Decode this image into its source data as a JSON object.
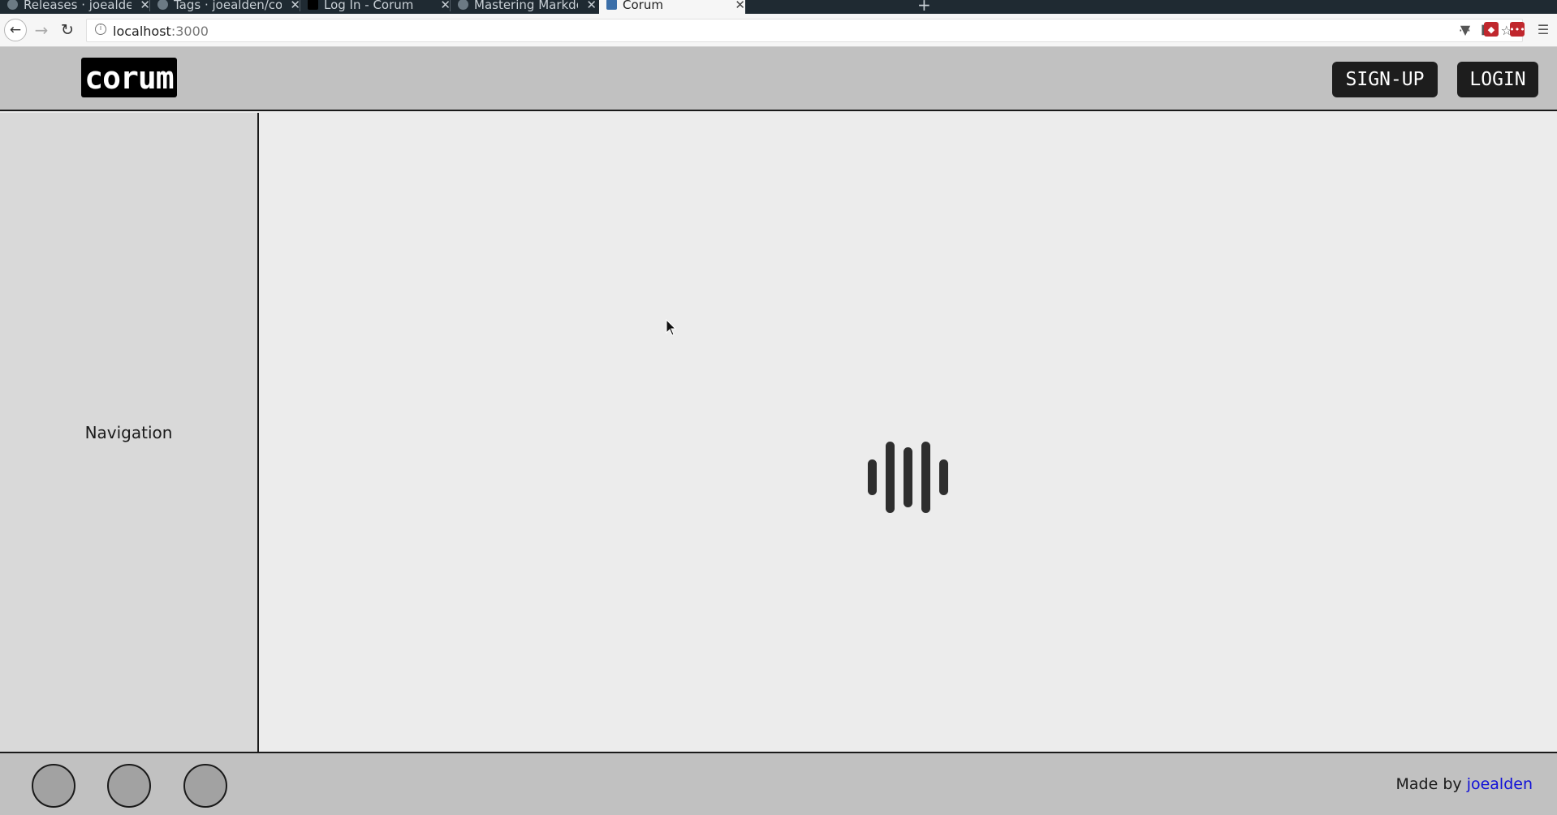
{
  "browser": {
    "tabs": [
      {
        "title": "Releases · joealden/corum",
        "active": false
      },
      {
        "title": "Tags · joealden/corum",
        "active": false
      },
      {
        "title": "Log In - Corum",
        "active": false
      },
      {
        "title": "Mastering Markdown",
        "active": false
      },
      {
        "title": "Corum",
        "active": true
      }
    ],
    "url_host": "localhost",
    "url_port": ":3000"
  },
  "header": {
    "logo_text": "corum",
    "signup_label": "SIGN-UP",
    "login_label": "LOGIN"
  },
  "sidebar": {
    "label": "Navigation"
  },
  "main": {
    "state": "loading"
  },
  "footer": {
    "credit_prefix": "Made by",
    "credit_link": "joealden",
    "social_count": 3
  },
  "colors": {
    "header_bg": "#c1c1c1",
    "sidebar_bg": "#d9d9d9",
    "main_bg": "#ececec",
    "button_bg": "#1d1d1d",
    "link": "#1010d8"
  }
}
